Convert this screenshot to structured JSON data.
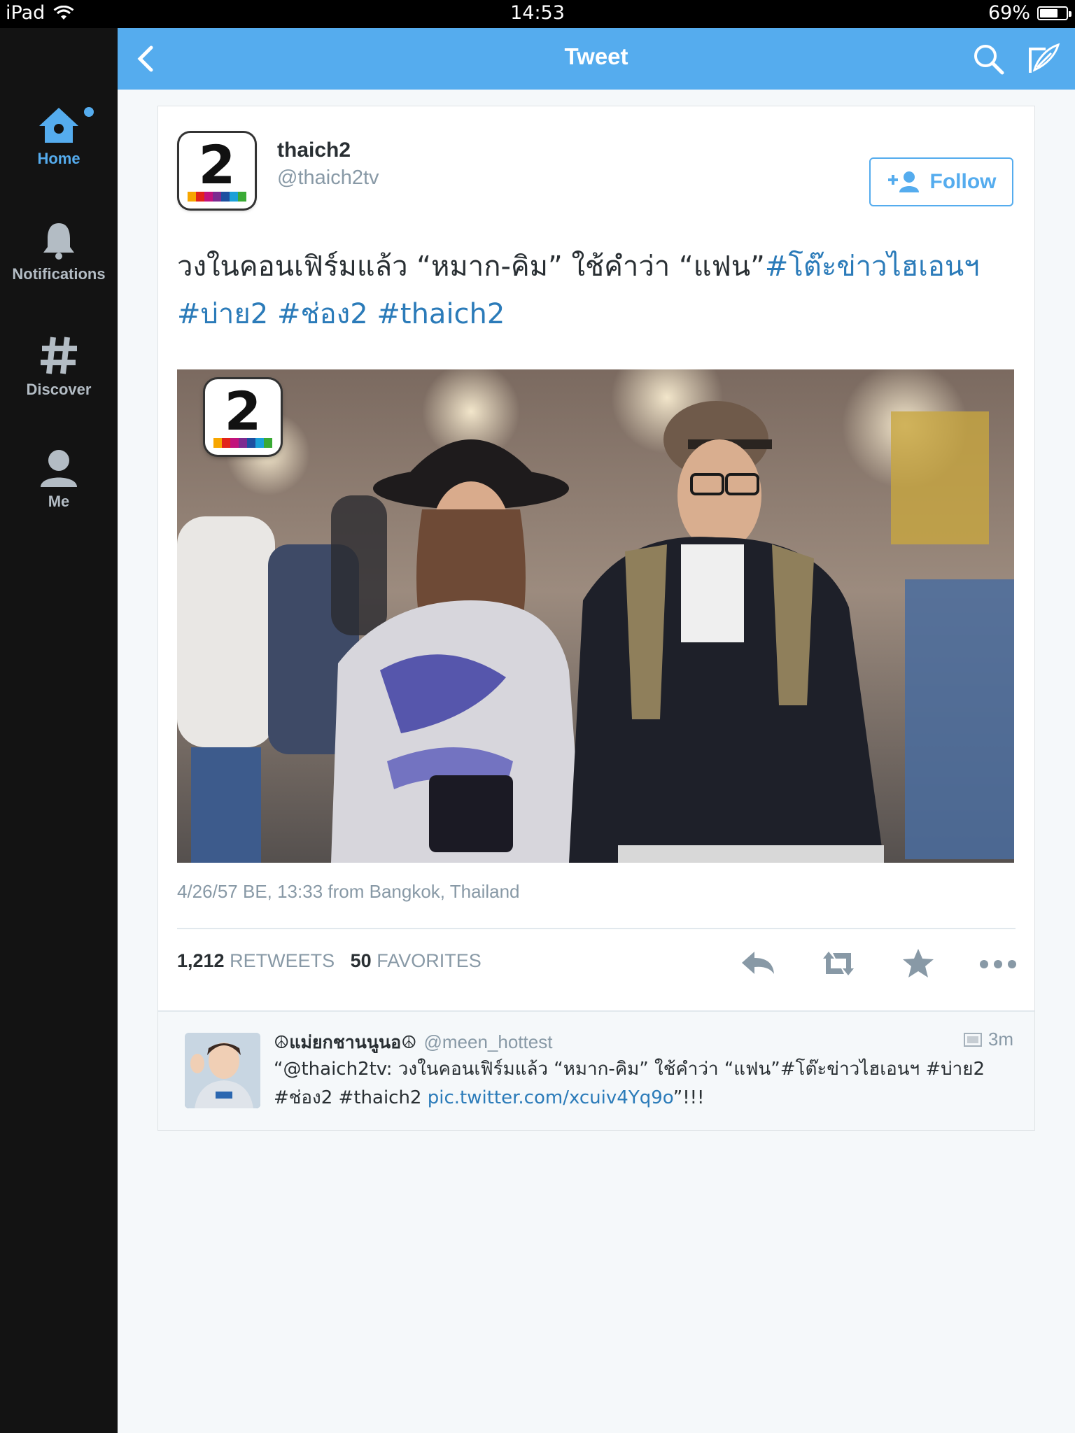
{
  "status_bar": {
    "device": "iPad",
    "time": "14:53",
    "battery": "69%",
    "battery_level": 0.69
  },
  "sidebar": {
    "items": [
      {
        "label": "Home",
        "icon": "birdhouse-icon",
        "active": true
      },
      {
        "label": "Notifications",
        "icon": "bell-icon",
        "active": false
      },
      {
        "label": "Discover",
        "icon": "hashtag-icon",
        "active": false
      },
      {
        "label": "Me",
        "icon": "person-icon",
        "active": false
      }
    ]
  },
  "header": {
    "title": "Tweet",
    "icons": [
      "back-chevron-icon",
      "search-icon",
      "compose-icon"
    ]
  },
  "tweet": {
    "name": "thaich2",
    "handle": "@thaich2tv",
    "follow_label": "Follow",
    "avatar_text": "2",
    "text_plain": "วงในคอนเฟิร์มแล้ว “หมาก-คิม” ใช้คำว่า “แฟน”",
    "hashtags": [
      "#โต๊ะข่าวไฮเอนฯ",
      "#บ่าย2",
      "#ช่อง2",
      "#thaich2"
    ],
    "photo_badge": "2",
    "meta": "4/26/57 BE, 13:33 from Bangkok, Thailand",
    "retweets_count": "1,212",
    "retweets_label": "RETWEETS",
    "favorites_count": "50",
    "favorites_label": "FAVORITES",
    "actions": [
      "reply-icon",
      "retweet-icon",
      "favorite-star-icon",
      "more-icon"
    ]
  },
  "reply": {
    "name": "☮แม่ยกชานนูนอ☮",
    "handle": "@meen_hottest",
    "time": "3m",
    "text_before": "“@thaich2tv: วงในคอนเฟิร์มแล้ว “หมาก-คิม” ใช้คำว่า “แฟน”#โต๊ะข่าวไฮเอนฯ #บ่าย2 #ช่อง2 #thaich2 ",
    "link": "pic.twitter.com/xcuiv4Yq9o",
    "text_after": "”!!!"
  },
  "colors": {
    "accent": "#55acee",
    "link": "#2b7bb9",
    "sidebar_bg": "#131313",
    "text": "#292f33",
    "muted": "#8899a6"
  }
}
